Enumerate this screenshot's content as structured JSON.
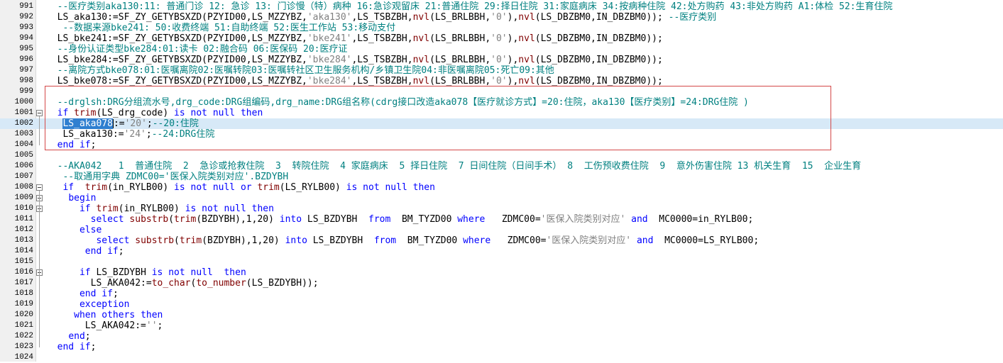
{
  "editor": {
    "lines": [
      {
        "no": "991",
        "text": "  --医疗类别aka130:11: 普通门诊 12: 急诊 13: 门诊慢（特）病种 16:急诊观留床 21:普通住院 29:择日住院 31:家庭病床 34:按病种住院 42:处方购药 43:非处方购药 A1:体检 52:生育住院"
      },
      {
        "no": "992",
        "text": "  LS_aka130:=SF_ZY_GETYBSXZD(PZYID00,LS_MZZYBZ,'aka130',LS_TSBZBH,nvl(LS_BRLBBH,'0'),nvl(LS_DBZBM0,IN_DBZBM0)); --医疗类别"
      },
      {
        "no": "993",
        "text": "   --数据来源bke241: 50:收费终端 51:自助终端 52:医生工作站 53:移动支付"
      },
      {
        "no": "994",
        "text": "  LS_bke241:=SF_ZY_GETYBSXZD(PZYID00,LS_MZZYBZ,'bke241',LS_TSBZBH,nvl(LS_BRLBBH,'0'),nvl(LS_DBZBM0,IN_DBZBM0));"
      },
      {
        "no": "995",
        "text": "  --身份认证类型bke284:01:读卡 02:融合码 06:医保码 20:医疗证"
      },
      {
        "no": "996",
        "text": "  LS_bke284:=SF_ZY_GETYBSXZD(PZYID00,LS_MZZYBZ,'bke284',LS_TSBZBH,nvl(LS_BRLBBH,'0'),nvl(LS_DBZBM0,IN_DBZBM0));"
      },
      {
        "no": "997",
        "text": "  --离院方式bke078:01:医嘱离院02:医嘱转院03:医嘱转社区卫生服务机构/乡镇卫生院04:非医嘱离院05:死亡09:其他"
      },
      {
        "no": "998",
        "text": "  LS_bke078:=SF_ZY_GETYBSXZD(PZYID00,LS_MZZYBZ,'bke284',LS_TSBZBH,nvl(LS_BRLBBH,'0'),nvl(LS_DBZBM0,IN_DBZBM0));"
      },
      {
        "no": "999",
        "text": ""
      },
      {
        "no": "1000",
        "text": "  --drglsh:DRG分组流水号,drg_code:DRG组编码,drg_name:DRG组名称(cdrg接口改造aka078【医疗就诊方式】=20:住院，aka130【医疗类别】=24:DRG住院 )"
      },
      {
        "no": "1001",
        "text": "  if trim(LS_drg_code) is not null then"
      },
      {
        "no": "1002",
        "text": "   LS_aka078:='20';--20:住院"
      },
      {
        "no": "1003",
        "text": "   LS_aka130:='24';--24:DRG住院"
      },
      {
        "no": "1004",
        "text": "  end if;"
      },
      {
        "no": "1005",
        "text": ""
      },
      {
        "no": "1006",
        "text": "  --AKA042   1  普通住院  2  急诊或抢救住院  3  转院住院  4 家庭病床  5 择日住院  7 日间住院（日间手术） 8  工伤预收费住院  9  意外伤害住院 13 机关生育  15  企业生育"
      },
      {
        "no": "1007",
        "text": "   --取通用字典 ZDMC00='医保入院类别对应'.BZDYBH"
      },
      {
        "no": "1008",
        "text": "   if  trim(in_RYLB00) is not null or trim(LS_RYLB00) is not null then"
      },
      {
        "no": "1009",
        "text": "    begin"
      },
      {
        "no": "1010",
        "text": "      if trim(in_RYLB00) is not null then"
      },
      {
        "no": "1011",
        "text": "        select substrb(trim(BZDYBH),1,20) into LS_BZDYBH  from  BM_TYZD00 where   ZDMC00='医保入院类别对应' and  MC0000=in_RYLB00;"
      },
      {
        "no": "1012",
        "text": "      else"
      },
      {
        "no": "1013",
        "text": "         select substrb(trim(BZDYBH),1,20) into LS_BZDYBH  from  BM_TYZD00 where   ZDMC00='医保入院类别对应' and  MC0000=LS_RYLB00;"
      },
      {
        "no": "1014",
        "text": "       end if;"
      },
      {
        "no": "1015",
        "text": ""
      },
      {
        "no": "1016",
        "text": "      if LS_BZDYBH is not null  then"
      },
      {
        "no": "1017",
        "text": "        LS_AKA042:=to_char(to_number(LS_BZDYBH));"
      },
      {
        "no": "1018",
        "text": "      end if;"
      },
      {
        "no": "1019",
        "text": "      exception"
      },
      {
        "no": "1020",
        "text": "     when others then"
      },
      {
        "no": "1021",
        "text": "       LS_AKA042:='';"
      },
      {
        "no": "1022",
        "text": "    end;"
      },
      {
        "no": "1023",
        "text": "  end if;"
      },
      {
        "no": "1024",
        "text": ""
      }
    ],
    "current_line": "1002",
    "selected_text": "LS_aka078",
    "fold_markers": [
      "1001",
      "1008",
      "1009",
      "1010",
      "1016"
    ],
    "colors": {
      "keyword": "#0000ff",
      "comment": "#008080",
      "string": "#808080",
      "function": "#800000",
      "selection": "#2f7fd0",
      "current_line": "#d7e9f7",
      "highlight_box": "#d44848"
    }
  }
}
